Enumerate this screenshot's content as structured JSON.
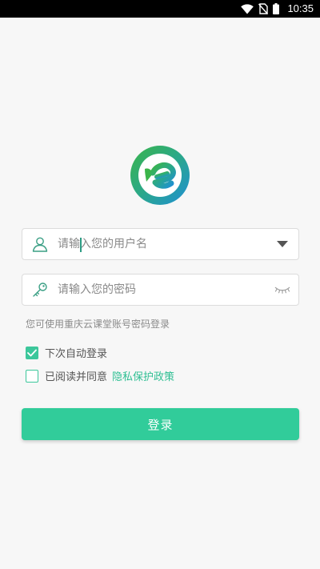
{
  "status_bar": {
    "time": "10:35",
    "icons": [
      "wifi-icon",
      "no-sim-icon",
      "battery-icon"
    ]
  },
  "logo": {
    "icon": "app-logo"
  },
  "username_field": {
    "placeholder": "请输入您的用户名",
    "value": "",
    "leading_icon": "user-icon",
    "trailing_icon": "dropdown-arrow-icon"
  },
  "password_field": {
    "placeholder": "请输入您的密码",
    "value": "",
    "leading_icon": "key-icon",
    "trailing_icon": "eye-closed-icon"
  },
  "hint": "您可使用重庆云课堂账号密码登录",
  "auto_login": {
    "label": "下次自动登录",
    "checked": true
  },
  "agreement": {
    "label": "已阅读并同意",
    "link": "隐私保护政策",
    "checked": false
  },
  "login_button": {
    "label": "登录"
  },
  "colors": {
    "accent": "#31cc9a",
    "link": "#2fbf93",
    "logo_green": "#3bb54a",
    "logo_blue": "#1f8fd6"
  }
}
